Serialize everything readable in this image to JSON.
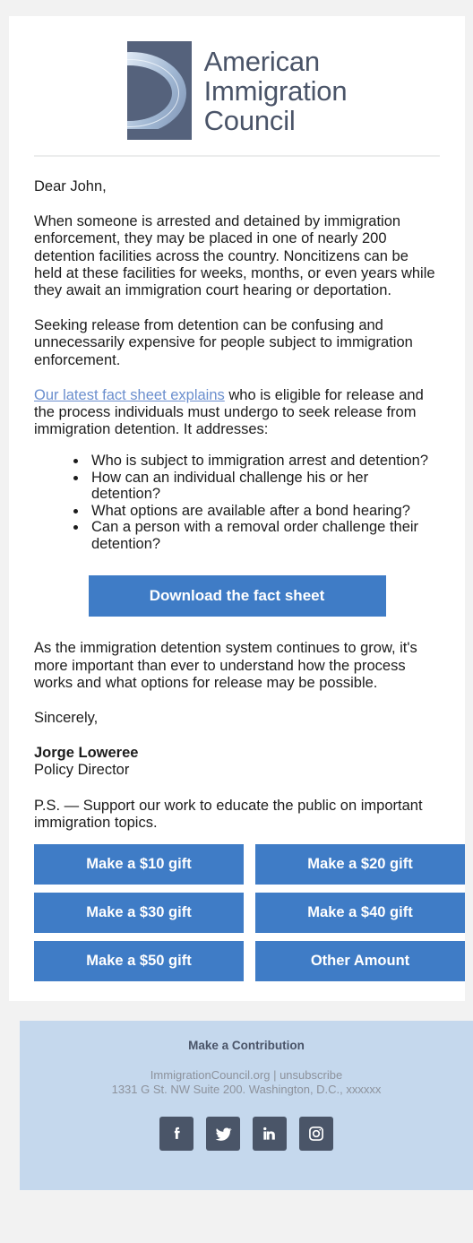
{
  "colors": {
    "page_background": "#f2f2f2",
    "card_background": "#ffffff",
    "brand_blue": "#3f7cc6",
    "link_blue": "#6b8fce",
    "logo_slate": "#55627c",
    "footer_background": "#c5d8ed",
    "footer_text": "#8d929c",
    "social_icon": "#4a5568"
  },
  "header": {
    "logo_line1": "American",
    "logo_line2": "Immigration",
    "logo_line3": "Council"
  },
  "body": {
    "salutation": "Dear John,",
    "paragraph1": "When someone is arrested and detained by immigration enforcement, they may be placed in one of nearly 200 detention facilities across the country. Noncitizens can be held at these facilities for weeks, months, or even years while they await an immigration court hearing or deportation.",
    "paragraph2": "Seeking release from detention can be confusing and unnecessarily expensive for people subject to immigration enforcement.",
    "link_text": "Our latest fact sheet explains",
    "paragraph3_rest": " who is eligible for release and the process individuals must undergo to seek release from immigration detention. It addresses:",
    "bullets": [
      "Who is subject to immigration arrest and detention?",
      "How can an individual challenge his or her detention?",
      "What options are available after a bond hearing?",
      "Can a person with a removal order challenge their detention?"
    ],
    "cta_label": "Download the fact sheet",
    "paragraph4": "As the immigration detention system continues to grow, it's more important than ever to understand how the process works and what options for release may be possible.",
    "closing": "Sincerely,",
    "signature_name": "Jorge Loweree",
    "signature_title": "Policy Director",
    "postscript": "P.S. — Support our work to educate the public on important immigration topics."
  },
  "gifts": [
    {
      "label": "Make a $10 gift"
    },
    {
      "label": "Make a $20 gift"
    },
    {
      "label": "Make a $30 gift"
    },
    {
      "label": "Make a $40 gift"
    },
    {
      "label": "Make a $50 gift"
    },
    {
      "label": "Other Amount"
    }
  ],
  "footer": {
    "title": "Make a Contribution",
    "website": "ImmigrationCouncil.org",
    "separator": " | ",
    "unsubscribe": "unsubscribe",
    "address": "1331 G St. NW Suite 200. Washington, D.C., xxxxxx",
    "social": [
      {
        "name": "facebook"
      },
      {
        "name": "twitter"
      },
      {
        "name": "linkedin"
      },
      {
        "name": "instagram"
      }
    ]
  }
}
